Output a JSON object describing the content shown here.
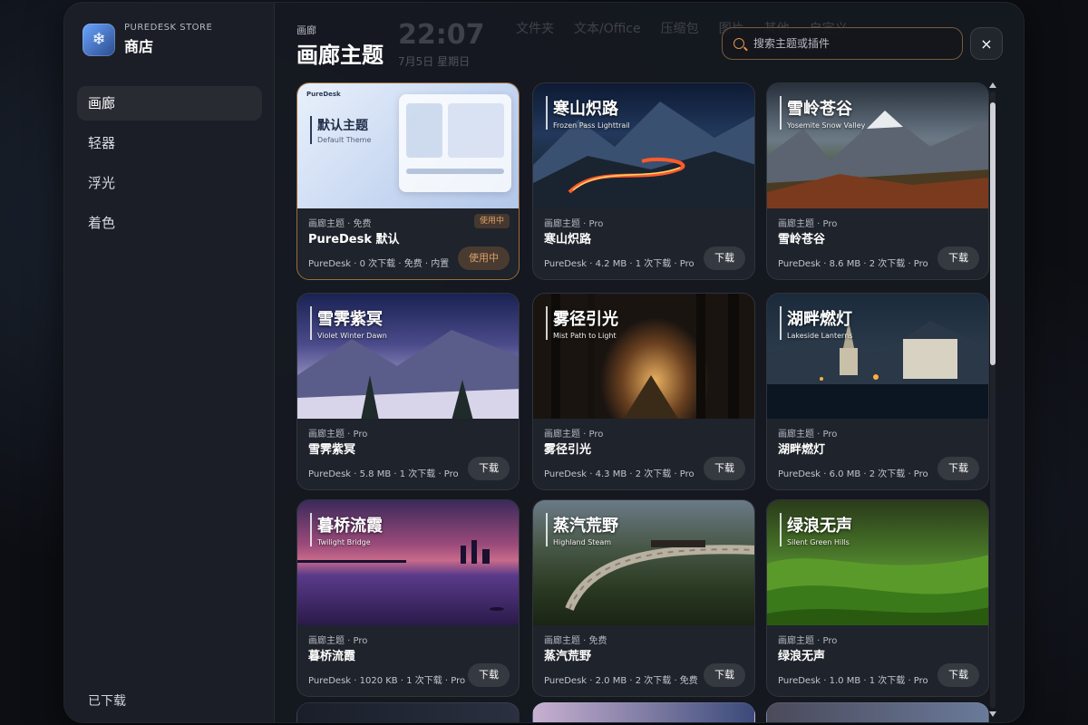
{
  "store": {
    "brand_sub": "PUREDESK STORE",
    "brand_title": "商店",
    "nav": [
      "画廊",
      "轻器",
      "浮光",
      "着色"
    ],
    "downloaded": "已下载"
  },
  "header": {
    "breadcrumb": "画廊",
    "title": "画廊主题",
    "ghost_clock": "22:07",
    "ghost_date": "7月5日 星期日",
    "ghost_tabs": [
      "文件夹",
      "文本/Office",
      "压缩包",
      "图片",
      "其他",
      "自定义"
    ]
  },
  "search": {
    "placeholder": "搜索主题或插件"
  },
  "close_label": "×",
  "cards": [
    {
      "zh": "默认主题",
      "en": "Default Theme",
      "meta": "画廊主题 · 免费",
      "name": "PureDesk 默认",
      "info": "PureDesk · 0 次下载 · 免费 · 内置",
      "button": "使用中",
      "badge": "使用中",
      "active": true
    },
    {
      "zh": "寒山炽路",
      "en": "Frozen Pass Lighttrail",
      "meta": "画廊主题 · Pro",
      "name": "寒山炽路",
      "info": "PureDesk · 4.2 MB · 1 次下载 · Pro",
      "button": "下载"
    },
    {
      "zh": "雪岭苍谷",
      "en": "Yosemite Snow Valley",
      "meta": "画廊主题 · Pro",
      "name": "雪岭苍谷",
      "info": "PureDesk · 8.6 MB · 2 次下载 · Pro",
      "button": "下载"
    },
    {
      "zh": "雪霁紫冥",
      "en": "Violet Winter Dawn",
      "meta": "画廊主题 · Pro",
      "name": "雪霁紫冥",
      "info": "PureDesk · 5.8 MB · 1 次下载 · Pro",
      "button": "下载"
    },
    {
      "zh": "雾径引光",
      "en": "Mist Path to Light",
      "meta": "画廊主题 · Pro",
      "name": "雾径引光",
      "info": "PureDesk · 4.3 MB · 2 次下载 · Pro",
      "button": "下载"
    },
    {
      "zh": "湖畔燃灯",
      "en": "Lakeside Lanterns",
      "meta": "画廊主题 · Pro",
      "name": "湖畔燃灯",
      "info": "PureDesk · 6.0 MB · 2 次下载 · Pro",
      "button": "下载"
    },
    {
      "zh": "暮桥流霞",
      "en": "Twilight Bridge",
      "meta": "画廊主题 · Pro",
      "name": "暮桥流霞",
      "info": "PureDesk · 1020 KB · 1 次下载 · Pro",
      "button": "下载"
    },
    {
      "zh": "蒸汽荒野",
      "en": "Highland Steam",
      "meta": "画廊主题 · 免费",
      "name": "蒸汽荒野",
      "info": "PureDesk · 2.0 MB · 2 次下载 · 免费",
      "button": "下载"
    },
    {
      "zh": "绿浪无声",
      "en": "Silent Green Hills",
      "meta": "画廊主题 · Pro",
      "name": "绿浪无声",
      "info": "PureDesk · 1.0 MB · 1 次下载 · Pro",
      "button": "下载"
    }
  ],
  "colors": {
    "accent": "#e0934d",
    "active_border": "#9c6a3c"
  }
}
